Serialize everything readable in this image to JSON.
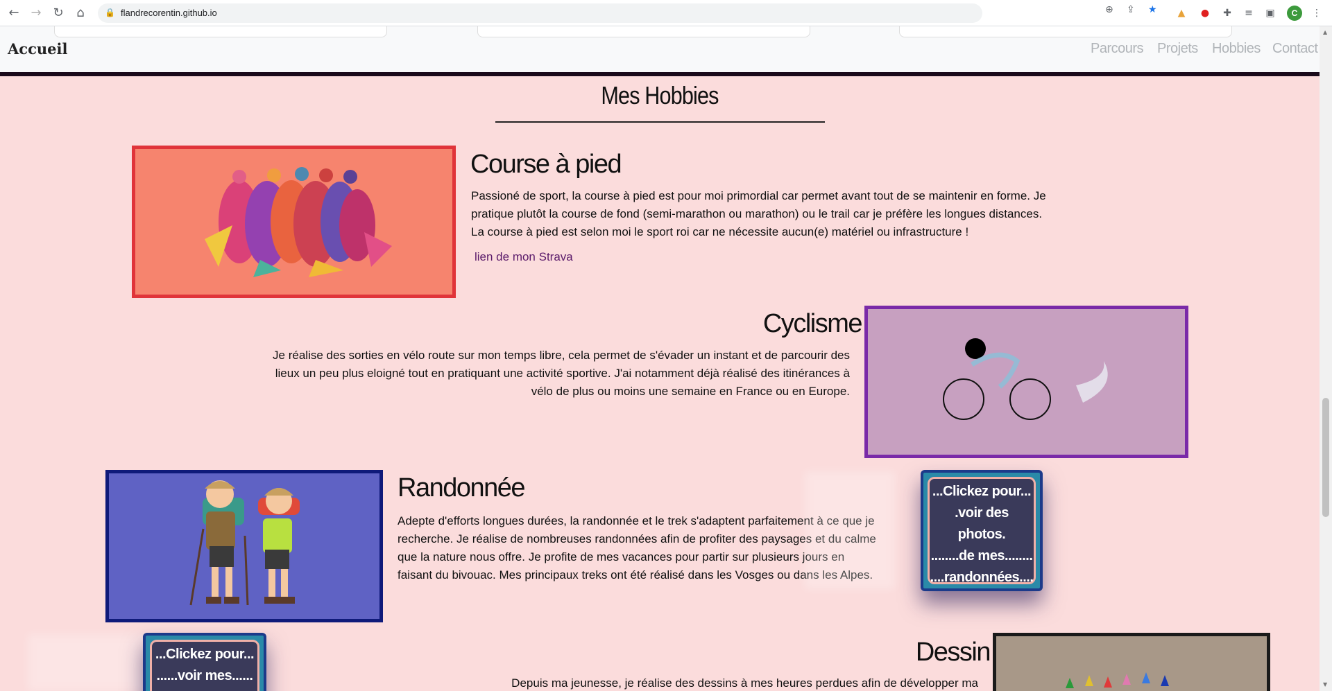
{
  "browser": {
    "url": "flandrecorentin.github.io",
    "profile_initial": "C",
    "extensions": [
      "zoom-icon",
      "share-icon",
      "bookmark-star-icon",
      "drive-icon",
      "opera-icon",
      "puzzle-icon",
      "media-icon",
      "sidepanel-icon"
    ]
  },
  "header": {
    "brand": "Accueil",
    "nav": [
      "Parcours",
      "Projets",
      "Hobbies",
      "Contact"
    ]
  },
  "section": {
    "title": "Mes Hobbies"
  },
  "hobbies": [
    {
      "title": "Course à pied",
      "text": "Passioné de sport, la course à pied est pour moi primordial car permet avant tout de se maintenir en forme. Je pratique plutôt la course de fond (semi-marathon ou marathon) ou le trail car je préfère les longues distances. La course à pied est selon moi le sport roi car ne nécessite aucun(e) matériel ou infrastructure !",
      "link": "lien de mon Strava"
    },
    {
      "title": "Cyclisme",
      "text": "Je réalise des sorties en vélo route sur mon temps libre, cela permet de s'évader un instant et de parcourir des lieux un peu plus eloigné tout en pratiquant une activité sportive. J'ai notamment déjà réalisé des itinérances à vélo de plus ou moins une semaine en France ou en Europe."
    },
    {
      "title": "Randonnée",
      "text": "Adepte d'efforts longues durées, la randonnée et le trek s'adaptent parfaitement à ce que je recherche. Je réalise de nombreuses randonnées afin de profiter des paysages et du calme que la nature nous offre. Je profite de mes vacances pour partir sur plusieurs jours en faisant du bivouac. Mes principaux treks ont été réalisé dans les Vosges ou dans les Alpes.",
      "button_lines": [
        "...Clickez pour...",
        ".voir des photos.",
        "........de mes........",
        "....randonnées...."
      ]
    },
    {
      "title": "Dessin",
      "text": "Depuis ma jeunesse, je réalise des dessins à mes heures perdues afin de développer ma créativité. Je",
      "button_lines": [
        "...Clickez pour...",
        "......voir mes......"
      ]
    }
  ],
  "colors": {
    "page_bg": "#fbdcdc",
    "running_frame": "#e0343a",
    "running_bg": "#f6846e",
    "cycling_frame": "#7a2aa8",
    "cycling_bg": "#c7a0c0",
    "hiking_frame": "#0f1a7a",
    "hiking_bg": "#5f62c4",
    "drawing_frame": "#1a1a1a",
    "drawing_bg": "#a89888"
  }
}
